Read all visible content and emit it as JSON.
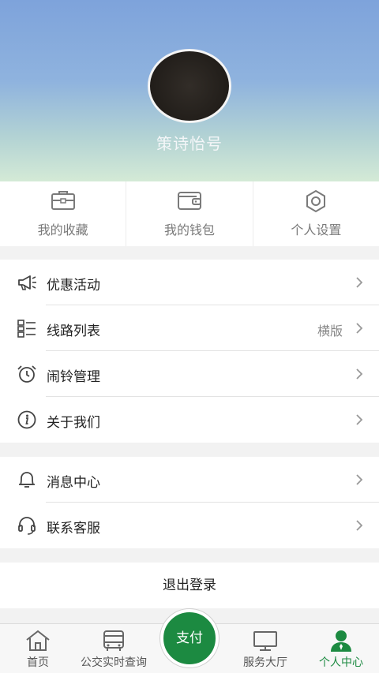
{
  "profile": {
    "username": "策诗怡号"
  },
  "quick_actions": [
    {
      "label": "我的收藏",
      "icon": "briefcase-icon"
    },
    {
      "label": "我的钱包",
      "icon": "wallet-icon"
    },
    {
      "label": "个人设置",
      "icon": "settings-gear-icon"
    }
  ],
  "menu_group1": [
    {
      "label": "优惠活动",
      "icon": "megaphone-icon"
    },
    {
      "label": "线路列表",
      "icon": "list-icon",
      "extra": "横版"
    },
    {
      "label": "闹铃管理",
      "icon": "alarm-clock-icon"
    },
    {
      "label": "关于我们",
      "icon": "info-icon"
    }
  ],
  "menu_group2": [
    {
      "label": "消息中心",
      "icon": "bell-icon"
    },
    {
      "label": "联系客服",
      "icon": "headset-icon"
    }
  ],
  "logout": {
    "label": "退出登录"
  },
  "tabbar": {
    "items": [
      {
        "label": "首页",
        "icon": "home-icon"
      },
      {
        "label": "公交实时查询",
        "icon": "bus-icon"
      },
      {
        "label": "服务大厅",
        "icon": "monitor-icon"
      },
      {
        "label": "个人中心",
        "icon": "user-icon",
        "active": true
      }
    ],
    "pay_label": "支付"
  },
  "colors": {
    "accent": "#1c8a41",
    "header_top": "#7ea3db",
    "header_bottom": "#d4ead6"
  }
}
